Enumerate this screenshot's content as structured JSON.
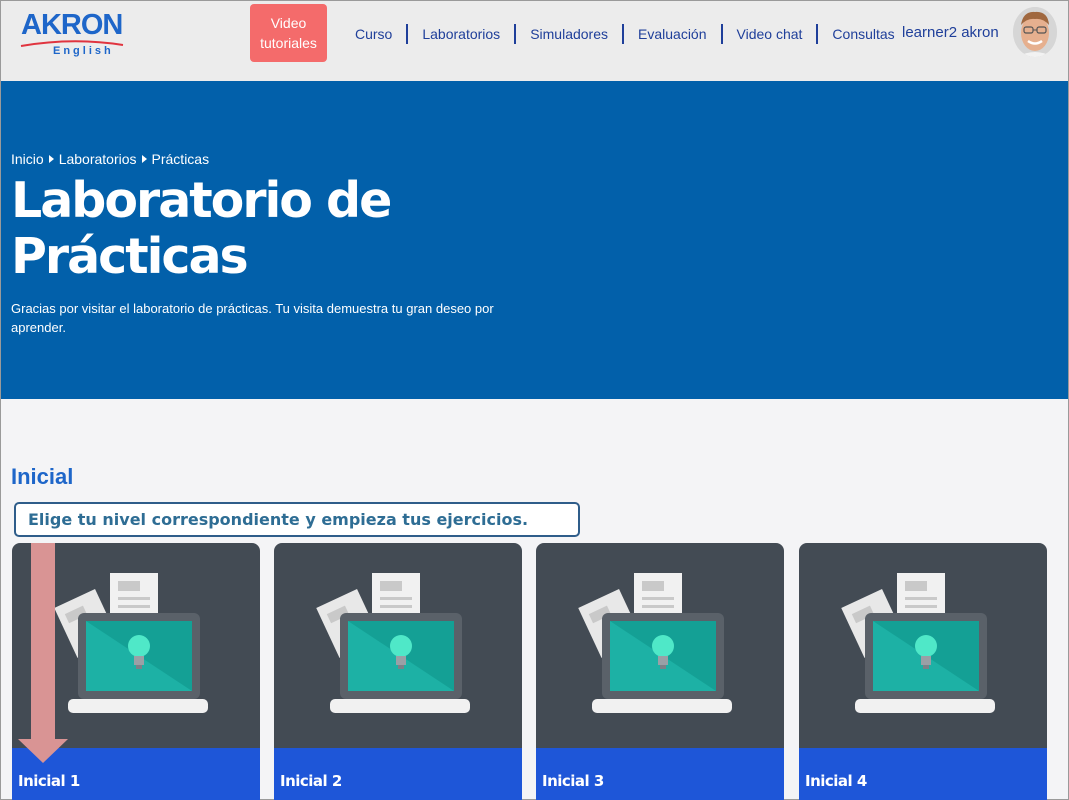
{
  "header": {
    "logo_text": "AKRON",
    "logo_sub": "English",
    "video_button": "Video\ntutoriales",
    "video_line1": "Video",
    "video_line2": "tutoriales",
    "nav": [
      {
        "label": "Curso"
      },
      {
        "label": "Laboratorios"
      },
      {
        "label": "Simuladores"
      },
      {
        "label": "Evaluación"
      },
      {
        "label": "Video chat"
      },
      {
        "label": "Consultas"
      }
    ],
    "user_name": "learner2 akron"
  },
  "hero": {
    "breadcrumb": [
      "Inicio",
      "Laboratorios",
      "Prácticas"
    ],
    "title_line1": "Laboratorio de",
    "title_line2": "Prácticas",
    "description": "Gracias por visitar el laboratorio de prácticas. Tu visita demuestra tu gran deseo por aprender."
  },
  "section": {
    "title": "Inicial",
    "callout": "Elige tu nivel correspondiente y empieza tus ejercicios.",
    "cards": [
      {
        "label": "Inicial 1"
      },
      {
        "label": "Inicial 2"
      },
      {
        "label": "Inicial 3"
      },
      {
        "label": "Inicial 4"
      }
    ]
  },
  "colors": {
    "brand_blue": "#1e66c9",
    "hero_blue": "#0260aa",
    "nav_blue": "#1f3f9a",
    "video_button": "#f46b6b",
    "card_bg": "#434b54",
    "card_footer": "#1e56d8",
    "annotation_arrow": "#d99494"
  }
}
